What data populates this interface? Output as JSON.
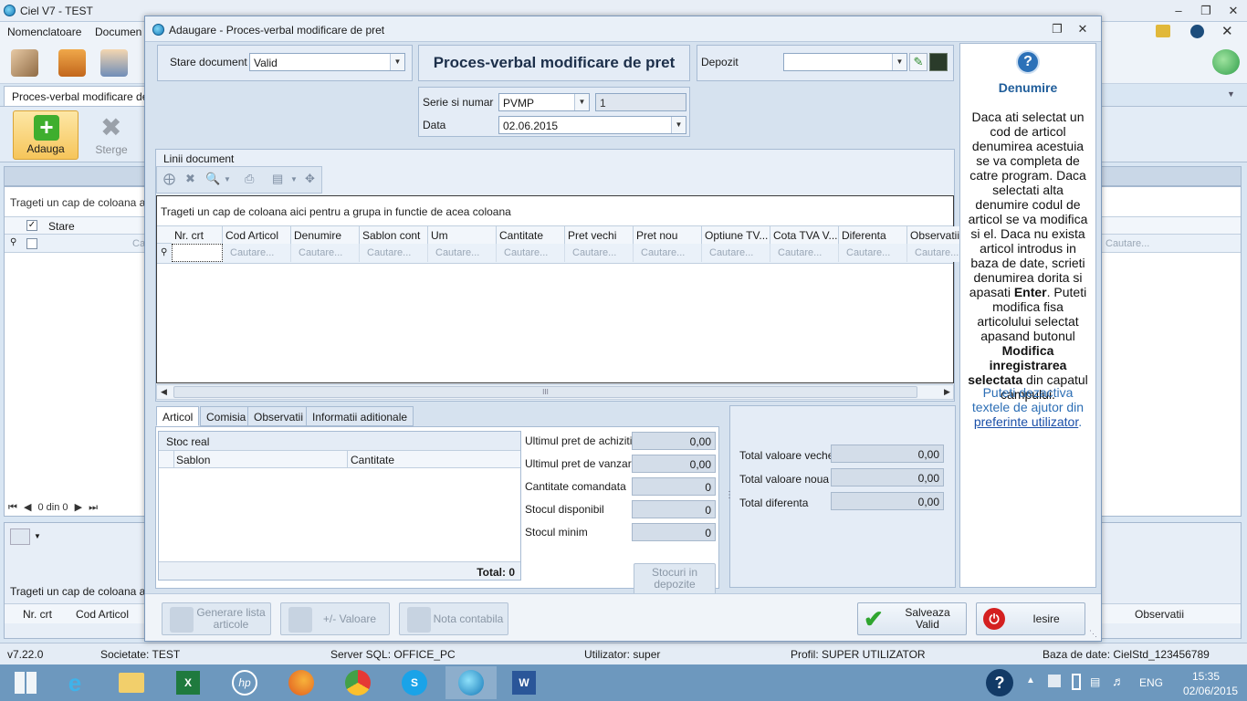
{
  "app": {
    "title": "Ciel V7 - TEST"
  },
  "menu": [
    "Nomenclatoare",
    "Documen"
  ],
  "left": {
    "tab_label": "Proces-verbal modificare de pr",
    "add_label": "Adauga",
    "delete_label": "Sterge",
    "group_hint": "Trageti un cap de coloana aici p",
    "col_stare": "Stare",
    "filter_text": "Ca",
    "filter_right": "Cautare...",
    "pager": "0 din 0",
    "bottom_hint": "Trageti un cap de coloana aici",
    "bottom_cols": [
      "Nr. crt",
      "Cod Articol"
    ],
    "bottom_right_col": "Observatii"
  },
  "dialog": {
    "title": "Adaugare - Proces-verbal modificare de pret",
    "doc_title": "Proces-verbal modificare de pret",
    "stare_label": "Stare document",
    "stare_value": "Valid",
    "depozit_label": "Depozit",
    "depozit_value": "",
    "serie_label": "Serie si numar",
    "serie_value": "PVMP",
    "numar_value": "1",
    "data_label": "Data",
    "data_value": "02.06.2015",
    "lines_caption": "Linii document",
    "group_hint": "Trageti un cap de coloana aici pentru a grupa in functie de acea coloana",
    "columns": [
      "Nr. crt",
      "Cod Articol",
      "Denumire",
      "Sablon cont",
      "Um",
      "Cantitate",
      "Pret vechi",
      "Pret nou",
      "Optiune TV...",
      "Cota TVA V...",
      "Diferenta",
      "Observatii"
    ],
    "filter_text": "Cautare...",
    "scroll_grip": "III",
    "tabs": [
      "Articol",
      "Comisia",
      "Observatii",
      "Informatii aditionale"
    ],
    "stoc_caption": "Stoc real",
    "stoc_cols": [
      "Sablon",
      "Cantitate"
    ],
    "stoc_total": "Total: 0",
    "fields": [
      {
        "label": "Ultimul pret de achizitie",
        "value": "0,00"
      },
      {
        "label": "Ultimul pret de vanzare",
        "value": "0,00"
      },
      {
        "label": "Cantitate comandata",
        "value": "0"
      },
      {
        "label": "Stocul disponibil",
        "value": "0"
      },
      {
        "label": "Stocul minim",
        "value": "0"
      }
    ],
    "stocuri_btn": "Stocuri in depozite",
    "totals": [
      {
        "label": "Total valoare veche",
        "value": "0,00"
      },
      {
        "label": "Total valoare noua",
        "value": "0,00"
      },
      {
        "label": "Total diferenta",
        "value": "0,00"
      }
    ],
    "btn_generare": "Generare lista articole",
    "btn_valoare": "+/- Valoare",
    "btn_nota": "Nota contabila",
    "btn_salveaza": "Salveaza Valid",
    "btn_iesire": "Iesire"
  },
  "help": {
    "title": "Denumire",
    "p1_a": "Daca ati selectat un cod de articol denumirea acestuia se va completa de catre program. Daca selectati alta denumire codul de articol se va modifica si el. Daca nu exista articol introdus in baza de date, scrieti denumirea dorita si apasati ",
    "p1_b": "Enter",
    "p1_c": ". Puteti modifica fisa articolului selectat apasand butonul ",
    "p1_d": "Modifica inregistrarea selectata",
    "p1_e": " din capatul campului.",
    "p2": "Puteti dezactiva textele de ajutor din ",
    "p2_link": "preferinte utilizator",
    "p2_end": "."
  },
  "status": {
    "version": "v7.22.0",
    "societate": "Societate: TEST",
    "server": "Server SQL: OFFICE_PC",
    "utilizator": "Utilizator: super",
    "profil": "Profil: SUPER UTILIZATOR",
    "baza": "Baza de date: CielStd_123456789"
  },
  "taskbar": {
    "lang": "ENG",
    "time": "15:35",
    "date": "02/06/2015"
  },
  "colors": {
    "accent": "#1f6fb5",
    "help_link": "#1a5fb4",
    "close_red": "#d42020",
    "check_green": "#2fa52f"
  }
}
